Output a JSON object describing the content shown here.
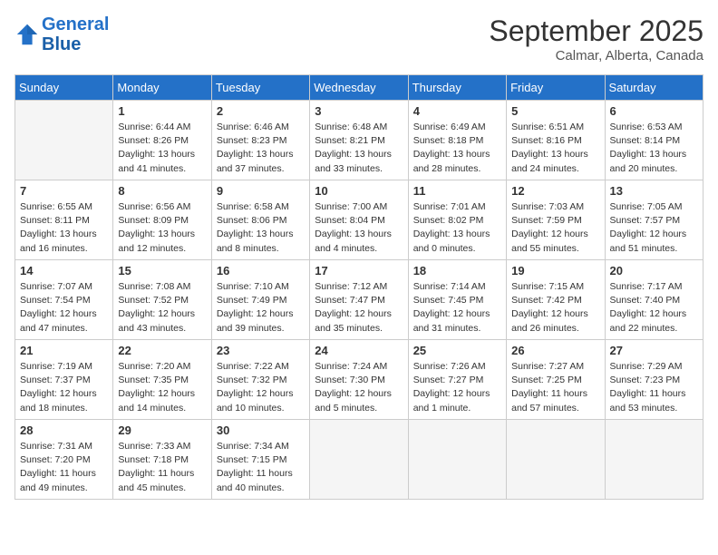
{
  "header": {
    "logo_line1": "General",
    "logo_line2": "Blue",
    "month": "September 2025",
    "location": "Calmar, Alberta, Canada"
  },
  "columns": [
    "Sunday",
    "Monday",
    "Tuesday",
    "Wednesday",
    "Thursday",
    "Friday",
    "Saturday"
  ],
  "weeks": [
    [
      {
        "day": "",
        "info": ""
      },
      {
        "day": "1",
        "info": "Sunrise: 6:44 AM\nSunset: 8:26 PM\nDaylight: 13 hours\nand 41 minutes."
      },
      {
        "day": "2",
        "info": "Sunrise: 6:46 AM\nSunset: 8:23 PM\nDaylight: 13 hours\nand 37 minutes."
      },
      {
        "day": "3",
        "info": "Sunrise: 6:48 AM\nSunset: 8:21 PM\nDaylight: 13 hours\nand 33 minutes."
      },
      {
        "day": "4",
        "info": "Sunrise: 6:49 AM\nSunset: 8:18 PM\nDaylight: 13 hours\nand 28 minutes."
      },
      {
        "day": "5",
        "info": "Sunrise: 6:51 AM\nSunset: 8:16 PM\nDaylight: 13 hours\nand 24 minutes."
      },
      {
        "day": "6",
        "info": "Sunrise: 6:53 AM\nSunset: 8:14 PM\nDaylight: 13 hours\nand 20 minutes."
      }
    ],
    [
      {
        "day": "7",
        "info": "Sunrise: 6:55 AM\nSunset: 8:11 PM\nDaylight: 13 hours\nand 16 minutes."
      },
      {
        "day": "8",
        "info": "Sunrise: 6:56 AM\nSunset: 8:09 PM\nDaylight: 13 hours\nand 12 minutes."
      },
      {
        "day": "9",
        "info": "Sunrise: 6:58 AM\nSunset: 8:06 PM\nDaylight: 13 hours\nand 8 minutes."
      },
      {
        "day": "10",
        "info": "Sunrise: 7:00 AM\nSunset: 8:04 PM\nDaylight: 13 hours\nand 4 minutes."
      },
      {
        "day": "11",
        "info": "Sunrise: 7:01 AM\nSunset: 8:02 PM\nDaylight: 13 hours\nand 0 minutes."
      },
      {
        "day": "12",
        "info": "Sunrise: 7:03 AM\nSunset: 7:59 PM\nDaylight: 12 hours\nand 55 minutes."
      },
      {
        "day": "13",
        "info": "Sunrise: 7:05 AM\nSunset: 7:57 PM\nDaylight: 12 hours\nand 51 minutes."
      }
    ],
    [
      {
        "day": "14",
        "info": "Sunrise: 7:07 AM\nSunset: 7:54 PM\nDaylight: 12 hours\nand 47 minutes."
      },
      {
        "day": "15",
        "info": "Sunrise: 7:08 AM\nSunset: 7:52 PM\nDaylight: 12 hours\nand 43 minutes."
      },
      {
        "day": "16",
        "info": "Sunrise: 7:10 AM\nSunset: 7:49 PM\nDaylight: 12 hours\nand 39 minutes."
      },
      {
        "day": "17",
        "info": "Sunrise: 7:12 AM\nSunset: 7:47 PM\nDaylight: 12 hours\nand 35 minutes."
      },
      {
        "day": "18",
        "info": "Sunrise: 7:14 AM\nSunset: 7:45 PM\nDaylight: 12 hours\nand 31 minutes."
      },
      {
        "day": "19",
        "info": "Sunrise: 7:15 AM\nSunset: 7:42 PM\nDaylight: 12 hours\nand 26 minutes."
      },
      {
        "day": "20",
        "info": "Sunrise: 7:17 AM\nSunset: 7:40 PM\nDaylight: 12 hours\nand 22 minutes."
      }
    ],
    [
      {
        "day": "21",
        "info": "Sunrise: 7:19 AM\nSunset: 7:37 PM\nDaylight: 12 hours\nand 18 minutes."
      },
      {
        "day": "22",
        "info": "Sunrise: 7:20 AM\nSunset: 7:35 PM\nDaylight: 12 hours\nand 14 minutes."
      },
      {
        "day": "23",
        "info": "Sunrise: 7:22 AM\nSunset: 7:32 PM\nDaylight: 12 hours\nand 10 minutes."
      },
      {
        "day": "24",
        "info": "Sunrise: 7:24 AM\nSunset: 7:30 PM\nDaylight: 12 hours\nand 5 minutes."
      },
      {
        "day": "25",
        "info": "Sunrise: 7:26 AM\nSunset: 7:27 PM\nDaylight: 12 hours\nand 1 minute."
      },
      {
        "day": "26",
        "info": "Sunrise: 7:27 AM\nSunset: 7:25 PM\nDaylight: 11 hours\nand 57 minutes."
      },
      {
        "day": "27",
        "info": "Sunrise: 7:29 AM\nSunset: 7:23 PM\nDaylight: 11 hours\nand 53 minutes."
      }
    ],
    [
      {
        "day": "28",
        "info": "Sunrise: 7:31 AM\nSunset: 7:20 PM\nDaylight: 11 hours\nand 49 minutes."
      },
      {
        "day": "29",
        "info": "Sunrise: 7:33 AM\nSunset: 7:18 PM\nDaylight: 11 hours\nand 45 minutes."
      },
      {
        "day": "30",
        "info": "Sunrise: 7:34 AM\nSunset: 7:15 PM\nDaylight: 11 hours\nand 40 minutes."
      },
      {
        "day": "",
        "info": ""
      },
      {
        "day": "",
        "info": ""
      },
      {
        "day": "",
        "info": ""
      },
      {
        "day": "",
        "info": ""
      }
    ]
  ]
}
